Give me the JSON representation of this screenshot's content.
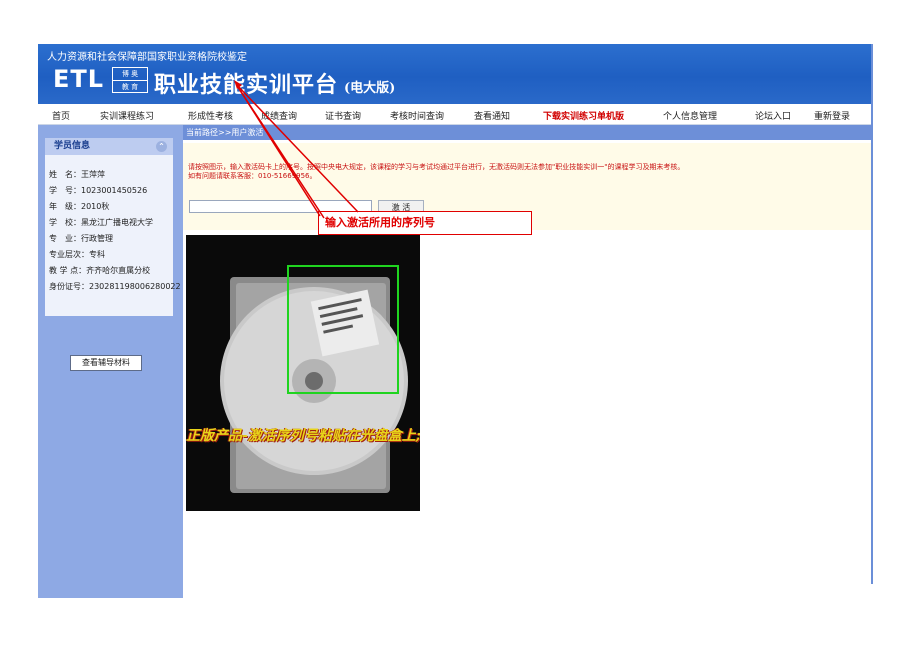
{
  "header": {
    "org_name": "人力资源和社会保障部国家职业资格院校鉴定",
    "logo_text": "ETL",
    "logo_sub_top": "博 奥",
    "logo_sub_bottom": "教 育",
    "app_title": "职业技能实训平台",
    "app_title_suffix": "(电大版)"
  },
  "nav": {
    "items": [
      "首页",
      "实训课程练习",
      "形成性考核",
      "成绩查询",
      "证书查询",
      "考核时间查询",
      "查看通知",
      "下载实训练习单机版",
      "个人信息管理",
      "论坛入口",
      "重新登录"
    ],
    "highlight_color": "#d10000"
  },
  "sidebar": {
    "title": "学员信息",
    "info_icon": "collapse-arrow-icon",
    "rows": [
      "姓　名：王萍萍",
      "学　号：1023001450526",
      "年　级：2010秋",
      "学　校：黑龙江广播电视大学",
      "专　业：行政管理",
      "专业层次：专科",
      "教 学 点：齐齐哈尔直属分校",
      "身份证号：230281198006280022"
    ],
    "materials_button": "查看辅导材料"
  },
  "main": {
    "breadcrumb": "当前路径>>用户激活",
    "notice_line1": "请按照图示，输入激活码卡上的序号。按照中央电大规定，该课程的学习与考试均通过平台进行，无激活码则无法参加\"职业技能实训一\"的课程学习及期末考核。",
    "notice_line2": "如有问题请联系客服：010-51669956。",
    "serial_input_value": "",
    "activate_button": "激 活",
    "callout": "输入激活所用的序列号",
    "photo_caption": "正版产品-激活序列号粘贴在光盘盒上;"
  },
  "colors": {
    "header_blue": "#2c6fcf",
    "sidebar_blue": "#8ea9e4",
    "annotation_red": "#e00000",
    "highlight_box_green": "#1fd41f"
  }
}
